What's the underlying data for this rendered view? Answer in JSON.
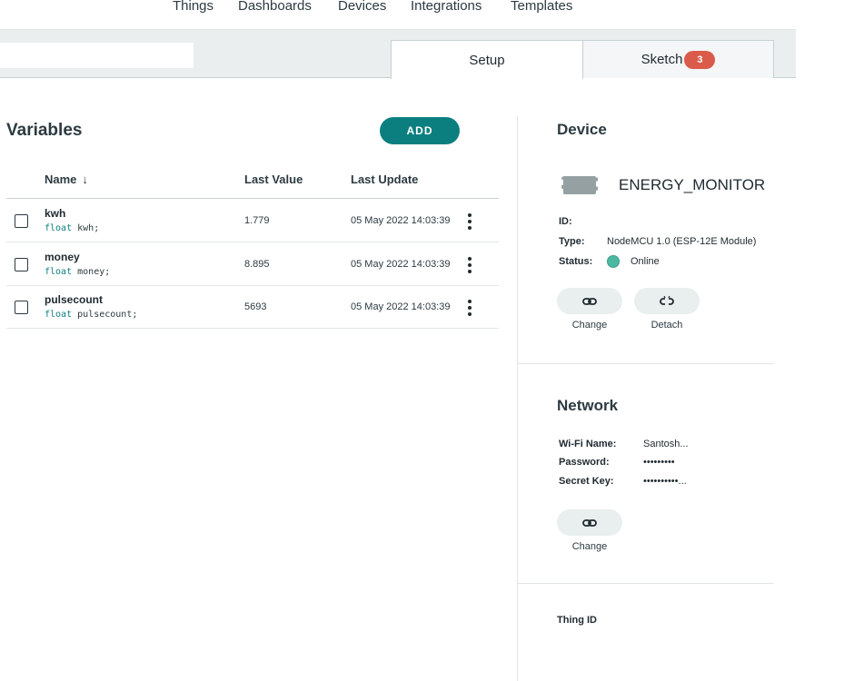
{
  "nav": {
    "items": [
      "Things",
      "Dashboards",
      "Devices",
      "Integrations",
      "Templates"
    ]
  },
  "tabs": {
    "setup_label": "Setup",
    "sketch_label": "Sketch",
    "sketch_badge": "3"
  },
  "variables": {
    "title": "Variables",
    "add_label": "ADD",
    "columns": {
      "name": "Name",
      "last_value": "Last Value",
      "last_update": "Last Update"
    },
    "rows": [
      {
        "name": "kwh",
        "type": "float",
        "decl": " kwh;",
        "value": "1.779",
        "updated": "05 May 2022 14:03:39"
      },
      {
        "name": "money",
        "type": "float",
        "decl": " money;",
        "value": "8.895",
        "updated": "05 May 2022 14:03:39"
      },
      {
        "name": "pulsecount",
        "type": "float",
        "decl": " pulsecount;",
        "value": "5693",
        "updated": "05 May 2022 14:03:39"
      }
    ]
  },
  "device": {
    "title": "Device",
    "name": "ENERGY_MONITOR",
    "id_label": "ID:",
    "type_label": "Type:",
    "type_value": "NodeMCU 1.0 (ESP-12E Module)",
    "status_label": "Status:",
    "status_value": "Online",
    "change_label": "Change",
    "detach_label": "Detach"
  },
  "network": {
    "title": "Network",
    "wifi_label": "Wi-Fi Name:",
    "wifi_value": "Santosh...",
    "password_label": "Password:",
    "password_value": "•••••••••",
    "secret_label": "Secret Key:",
    "secret_value": "••••••••••...",
    "change_label": "Change"
  },
  "thing": {
    "id_label": "Thing ID"
  },
  "colors": {
    "accent": "#0b7f7f",
    "badge": "#da5b4a",
    "online": "#4db8a2"
  },
  "icons": [
    "arrow-down-icon",
    "more-vertical-icon",
    "link-icon",
    "unlink-icon",
    "device-chip-icon"
  ]
}
